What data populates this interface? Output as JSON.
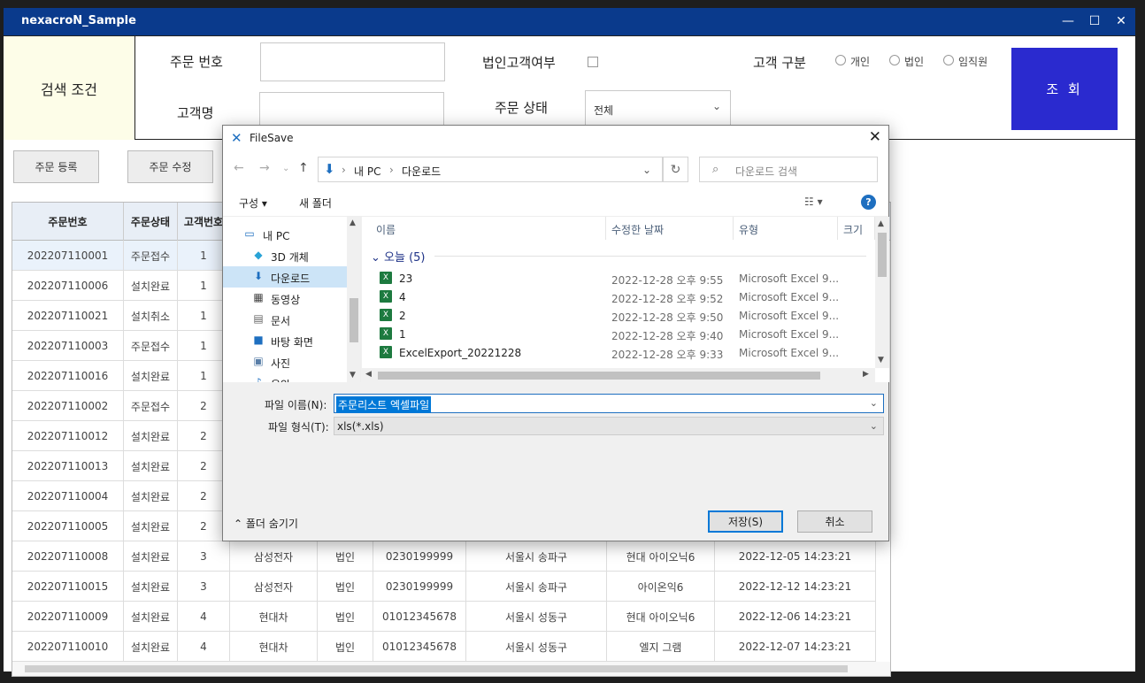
{
  "app": {
    "title": "nexacroN_Sample",
    "controls": {
      "minimize": "—",
      "maximize": "☐",
      "close": "✕"
    }
  },
  "search": {
    "title": "검색 조건",
    "order_no_label": "주문 번호",
    "order_no_value": "",
    "customer_name_label": "고객명",
    "customer_name_value": "",
    "corp_label": "법인고객여부",
    "status_label": "주문 상태",
    "status_value": "전체",
    "cust_type_label": "고객 구분",
    "cust_type_options": [
      "개인",
      "법인",
      "임직원"
    ],
    "query_button": "조 회"
  },
  "toolbar": {
    "register": "주문 등록",
    "edit": "주문 수정"
  },
  "grid": {
    "headers": [
      "주문번호",
      "주문상태",
      "고객번호",
      "",
      "",
      "",
      "",
      "",
      ""
    ],
    "rows": [
      [
        "202207110001",
        "주문접수",
        "1",
        "",
        "",
        "",
        "",
        "",
        ""
      ],
      [
        "202207110006",
        "설치완료",
        "1",
        "",
        "",
        "",
        "",
        "",
        ""
      ],
      [
        "202207110021",
        "설치취소",
        "1",
        "",
        "",
        "",
        "",
        "",
        ""
      ],
      [
        "202207110003",
        "주문접수",
        "1",
        "",
        "",
        "",
        "",
        "",
        ""
      ],
      [
        "202207110016",
        "설치완료",
        "1",
        "",
        "",
        "",
        "",
        "",
        ""
      ],
      [
        "202207110002",
        "주문접수",
        "2",
        "",
        "",
        "",
        "",
        "",
        ""
      ],
      [
        "202207110012",
        "설치완료",
        "2",
        "",
        "",
        "",
        "",
        "",
        ""
      ],
      [
        "202207110013",
        "설치완료",
        "2",
        "",
        "",
        "",
        "",
        "",
        ""
      ],
      [
        "202207110004",
        "설치완료",
        "2",
        "",
        "",
        "",
        "",
        "",
        ""
      ],
      [
        "202207110005",
        "설치완료",
        "2",
        "",
        "",
        "",
        "",
        "",
        ""
      ],
      [
        "202207110008",
        "설치완료",
        "3",
        "삼성전자",
        "법인",
        "0230199999",
        "서울시 송파구",
        "현대 아이오닉6",
        "2022-12-05 14:23:21"
      ],
      [
        "202207110015",
        "설치완료",
        "3",
        "삼성전자",
        "법인",
        "0230199999",
        "서울시 송파구",
        "아이온익6",
        "2022-12-12 14:23:21"
      ],
      [
        "202207110009",
        "설치완료",
        "4",
        "현대차",
        "법인",
        "01012345678",
        "서울시 성동구",
        "현대 아이오닉6",
        "2022-12-06 14:23:21"
      ],
      [
        "202207110010",
        "설치완료",
        "4",
        "현대차",
        "법인",
        "01012345678",
        "서울시 성동구",
        "엘지 그램",
        "2022-12-07 14:23:21"
      ]
    ]
  },
  "dialog": {
    "title": "FileSave",
    "breadcrumb": [
      "내 PC",
      "다운로드"
    ],
    "search_placeholder": "다운로드 검색",
    "organize": "구성 ▾",
    "new_folder": "새 폴더",
    "nav_items": [
      {
        "label": "내 PC",
        "icon": "computer-icon"
      },
      {
        "label": "3D 개체",
        "icon": "cube-icon"
      },
      {
        "label": "다운로드",
        "icon": "download-icon"
      },
      {
        "label": "동영상",
        "icon": "video-icon"
      },
      {
        "label": "문서",
        "icon": "document-icon"
      },
      {
        "label": "바탕 화면",
        "icon": "desktop-icon"
      },
      {
        "label": "사진",
        "icon": "picture-icon"
      },
      {
        "label": "음악",
        "icon": "music-icon"
      }
    ],
    "columns": [
      "이름",
      "수정한 날짜",
      "유형",
      "크기"
    ],
    "group_label": "오늘 (5)",
    "files": [
      {
        "name": "23",
        "date": "2022-12-28 오후 9:55",
        "type": "Microsoft Excel 9..."
      },
      {
        "name": "4",
        "date": "2022-12-28 오후 9:52",
        "type": "Microsoft Excel 9..."
      },
      {
        "name": "2",
        "date": "2022-12-28 오후 9:50",
        "type": "Microsoft Excel 9..."
      },
      {
        "name": "1",
        "date": "2022-12-28 오후 9:40",
        "type": "Microsoft Excel 9..."
      },
      {
        "name": "ExcelExport_20221228",
        "date": "2022-12-28 오후 9:33",
        "type": "Microsoft Excel 9..."
      }
    ],
    "filename_label": "파일 이름(N):",
    "filename_value": "주문리스트 엑셀파일",
    "filetype_label": "파일 형식(T):",
    "filetype_value": "xls(*.xls)",
    "hide_folders": "폴더 숨기기",
    "save_button": "저장(S)",
    "cancel_button": "취소"
  },
  "colors": {
    "titlebar": "#0a3a8c",
    "query_button": "#2a2acf",
    "selection": "#0078d7"
  }
}
